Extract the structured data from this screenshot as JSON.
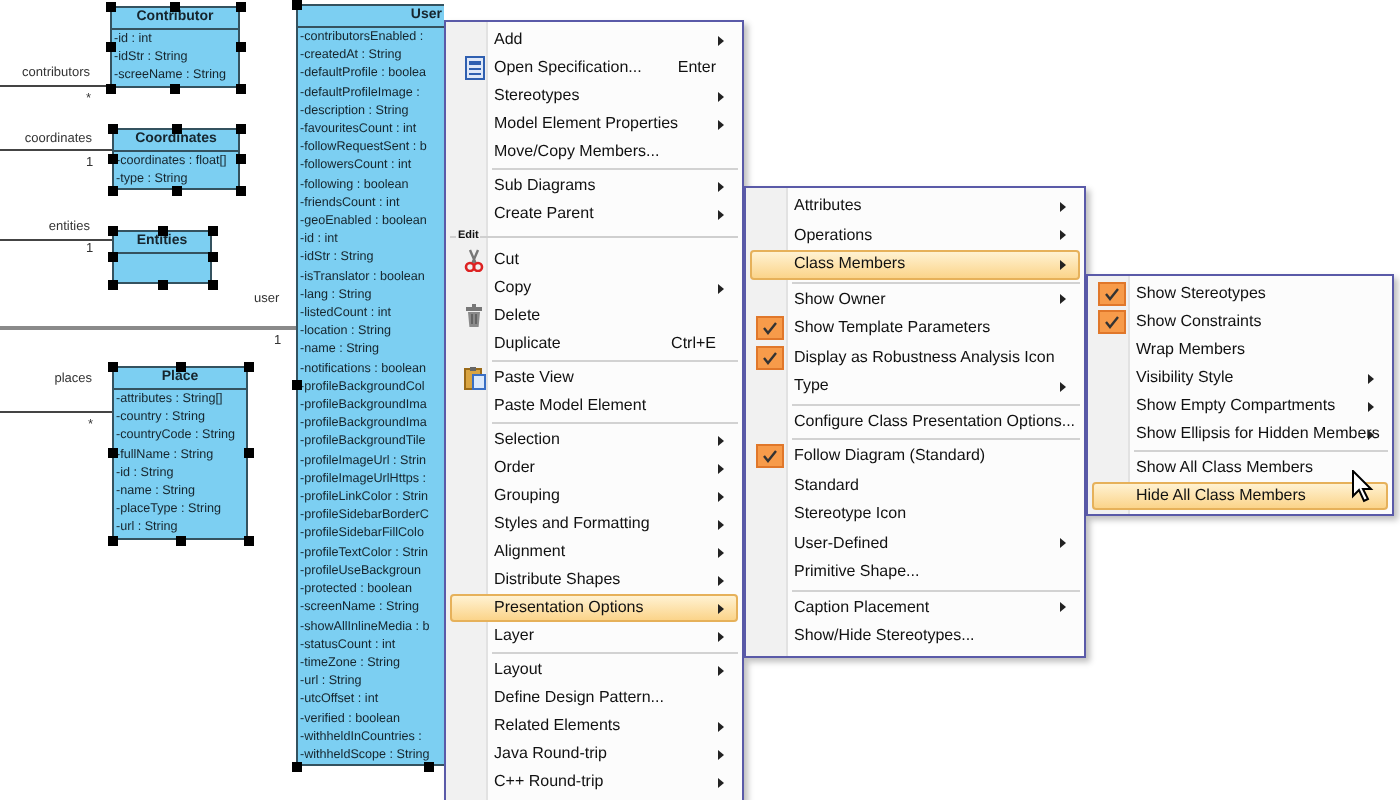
{
  "diagram": {
    "classes": [
      {
        "name": "Contributor",
        "selected": true,
        "attributes": [
          "-id : int",
          "-idStr : String",
          "-screeName : String"
        ]
      },
      {
        "name": "Coordinates",
        "selected": true,
        "attributes": [
          "-coordinates : float[]",
          "-type : String"
        ]
      },
      {
        "name": "Entities",
        "selected": true
      },
      {
        "name": "Place",
        "selected": true,
        "attributes": [
          "-attributes : String[]",
          "-country : String",
          "-countryCode : String",
          "-fullName : String",
          "-id : String",
          "-name : String",
          "-placeType : String",
          "-url : String"
        ]
      },
      {
        "name": "User",
        "selected": true,
        "attributes": [
          "-contributorsEnabled :",
          "-createdAt : String",
          "-defaultProfile : boolea",
          "-defaultProfileImage :",
          "-description : String",
          "-favouritesCount : int",
          "-followRequestSent : b",
          "-followersCount : int",
          "-following : boolean",
          "-friendsCount : int",
          "-geoEnabled : boolean",
          "-id : int",
          "-idStr : String",
          "-isTranslator : boolean",
          "-lang : String",
          "-listedCount : int",
          "-location : String",
          "-name : String",
          "-notifications : boolean",
          "-profileBackgroundCol",
          "-profileBackgroundIma",
          "-profileBackgroundIma",
          "-profileBackgroundTile",
          "-profileImageUrl : Strin",
          "-profileImageUrlHttps :",
          "-profileLinkColor : Strin",
          "-profileSidebarBorderC",
          "-profileSidebarFillColo",
          "-profileTextColor : Strin",
          "-profileUseBackgroun",
          "-protected : boolean",
          "-screenName : String",
          "-showAllInlineMedia : b",
          "-statusCount : int",
          "-timeZone : String",
          "-url : String",
          "-utcOffset : int",
          "-verified : boolean",
          "-withheldInCountries :",
          "-withheldScope : String"
        ]
      }
    ],
    "associations": [
      {
        "role": "contributors",
        "multiplicity": "*"
      },
      {
        "role": "coordinates",
        "multiplicity": "1"
      },
      {
        "role": "entities",
        "multiplicity": "1"
      },
      {
        "role": "user",
        "multiplicity": "1"
      },
      {
        "role": "places",
        "multiplicity": "*"
      }
    ]
  },
  "context_menu": {
    "items": [
      {
        "kind": "item",
        "label": "Add",
        "submenu": true,
        "selected": false
      },
      {
        "kind": "item",
        "label": "Open Specification...",
        "shortcut": "Enter",
        "submenu": false,
        "selected": false
      },
      {
        "kind": "item",
        "label": "Stereotypes",
        "submenu": true,
        "selected": false
      },
      {
        "kind": "item",
        "label": "Model Element Properties",
        "submenu": true,
        "selected": false
      },
      {
        "kind": "item",
        "label": "Move/Copy Members...",
        "submenu": false,
        "selected": false
      },
      {
        "kind": "separator"
      },
      {
        "kind": "item",
        "label": "Sub Diagrams",
        "submenu": true,
        "selected": false
      },
      {
        "kind": "item",
        "label": "Create Parent",
        "submenu": true,
        "selected": false
      },
      {
        "kind": "header",
        "label": "Edit"
      },
      {
        "kind": "item",
        "label": "Cut",
        "submenu": false,
        "selected": false
      },
      {
        "kind": "item",
        "label": "Copy",
        "submenu": true,
        "selected": false
      },
      {
        "kind": "item",
        "label": "Delete",
        "submenu": false,
        "selected": false
      },
      {
        "kind": "item",
        "label": "Duplicate",
        "shortcut": "Ctrl+E",
        "submenu": false,
        "selected": false
      },
      {
        "kind": "separator"
      },
      {
        "kind": "item",
        "label": "Paste View",
        "submenu": false,
        "selected": false
      },
      {
        "kind": "item",
        "label": "Paste Model Element",
        "submenu": false,
        "selected": false
      },
      {
        "kind": "separator"
      },
      {
        "kind": "item",
        "label": "Selection",
        "submenu": true,
        "selected": false
      },
      {
        "kind": "item",
        "label": "Order",
        "submenu": true,
        "selected": false
      },
      {
        "kind": "item",
        "label": "Grouping",
        "submenu": true,
        "selected": false
      },
      {
        "kind": "item",
        "label": "Styles and Formatting",
        "submenu": true,
        "selected": false
      },
      {
        "kind": "item",
        "label": "Alignment",
        "submenu": true,
        "selected": false
      },
      {
        "kind": "item",
        "label": "Distribute Shapes",
        "submenu": true,
        "selected": false
      },
      {
        "kind": "item",
        "label": "Presentation Options",
        "submenu": true,
        "selected": true
      },
      {
        "kind": "item",
        "label": "Layer",
        "submenu": true,
        "selected": false
      },
      {
        "kind": "separator"
      },
      {
        "kind": "item",
        "label": "Layout",
        "submenu": true,
        "selected": false
      },
      {
        "kind": "item",
        "label": "Define Design Pattern...",
        "submenu": false,
        "selected": false
      },
      {
        "kind": "item",
        "label": "Related Elements",
        "submenu": true,
        "selected": false
      },
      {
        "kind": "item",
        "label": "Java Round-trip",
        "submenu": true,
        "selected": false
      },
      {
        "kind": "item",
        "label": "C++ Round-trip",
        "submenu": true,
        "selected": false
      }
    ]
  },
  "presentation_submenu": {
    "items": [
      {
        "kind": "item",
        "label": "Attributes",
        "submenu": true,
        "checked": false,
        "selected": false
      },
      {
        "kind": "item",
        "label": "Operations",
        "submenu": true,
        "checked": false,
        "selected": false
      },
      {
        "kind": "item",
        "label": "Class Members",
        "submenu": true,
        "checked": false,
        "selected": true
      },
      {
        "kind": "separator"
      },
      {
        "kind": "item",
        "label": "Show Owner",
        "submenu": true,
        "checked": false,
        "selected": false
      },
      {
        "kind": "item",
        "label": "Show Template Parameters",
        "submenu": false,
        "checked": true,
        "selected": false
      },
      {
        "kind": "item",
        "label": "Display as Robustness Analysis Icon",
        "submenu": false,
        "checked": true,
        "selected": false
      },
      {
        "kind": "item",
        "label": "Type",
        "submenu": true,
        "checked": false,
        "selected": false
      },
      {
        "kind": "separator"
      },
      {
        "kind": "item",
        "label": "Configure Class Presentation Options...",
        "submenu": false,
        "checked": false,
        "selected": false
      },
      {
        "kind": "separator"
      },
      {
        "kind": "item",
        "label": "Follow Diagram (Standard)",
        "submenu": false,
        "checked": true,
        "selected": false
      },
      {
        "kind": "item",
        "label": "Standard",
        "submenu": false,
        "checked": false,
        "selected": false
      },
      {
        "kind": "item",
        "label": "Stereotype Icon",
        "submenu": false,
        "checked": false,
        "selected": false
      },
      {
        "kind": "item",
        "label": "User-Defined",
        "submenu": true,
        "checked": false,
        "selected": false
      },
      {
        "kind": "item",
        "label": "Primitive Shape...",
        "submenu": false,
        "checked": false,
        "selected": false
      },
      {
        "kind": "separator"
      },
      {
        "kind": "item",
        "label": "Caption Placement",
        "submenu": true,
        "checked": false,
        "selected": false
      },
      {
        "kind": "item",
        "label": "Show/Hide Stereotypes...",
        "submenu": false,
        "checked": false,
        "selected": false
      }
    ]
  },
  "class_members_submenu": {
    "items": [
      {
        "kind": "item",
        "label": "Show Stereotypes",
        "submenu": false,
        "checked": true,
        "selected": false
      },
      {
        "kind": "item",
        "label": "Show Constraints",
        "submenu": false,
        "checked": true,
        "selected": false
      },
      {
        "kind": "item",
        "label": "Wrap Members",
        "submenu": false,
        "checked": false,
        "selected": false
      },
      {
        "kind": "item",
        "label": "Visibility Style",
        "submenu": true,
        "checked": false,
        "selected": false
      },
      {
        "kind": "item",
        "label": "Show Empty Compartments",
        "submenu": true,
        "checked": false,
        "selected": false
      },
      {
        "kind": "item",
        "label": "Show Ellipsis for Hidden Members",
        "submenu": true,
        "checked": false,
        "selected": false
      },
      {
        "kind": "separator"
      },
      {
        "kind": "item",
        "label": "Show All Class Members",
        "submenu": false,
        "checked": false,
        "selected": false
      },
      {
        "kind": "item",
        "label": "Hide All Class Members",
        "submenu": false,
        "checked": false,
        "selected": true
      }
    ]
  }
}
